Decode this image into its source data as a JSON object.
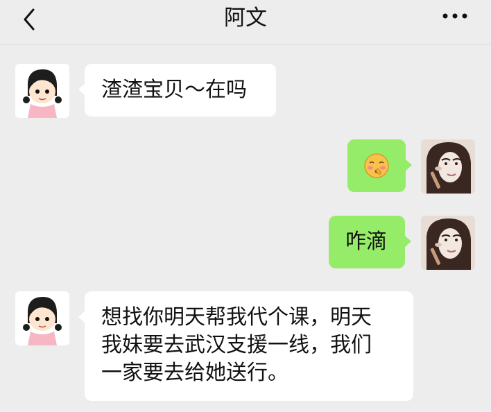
{
  "header": {
    "title": "阿文",
    "back_icon": "chevron-left-icon",
    "more_icon": "more-dots-icon"
  },
  "messages": [
    {
      "side": "left",
      "text": "渣渣宝贝～在吗"
    },
    {
      "side": "right",
      "sticker": "blushing-shush-emoji"
    },
    {
      "side": "right",
      "text": "咋滴"
    },
    {
      "side": "left",
      "text": "想找你明天帮我代个课，明天\n我妹要去武汉支援一线，我们\n一家要去给她送行。"
    }
  ],
  "colors": {
    "background": "#ededed",
    "bubble_self": "#95ec69",
    "bubble_other": "#ffffff"
  }
}
